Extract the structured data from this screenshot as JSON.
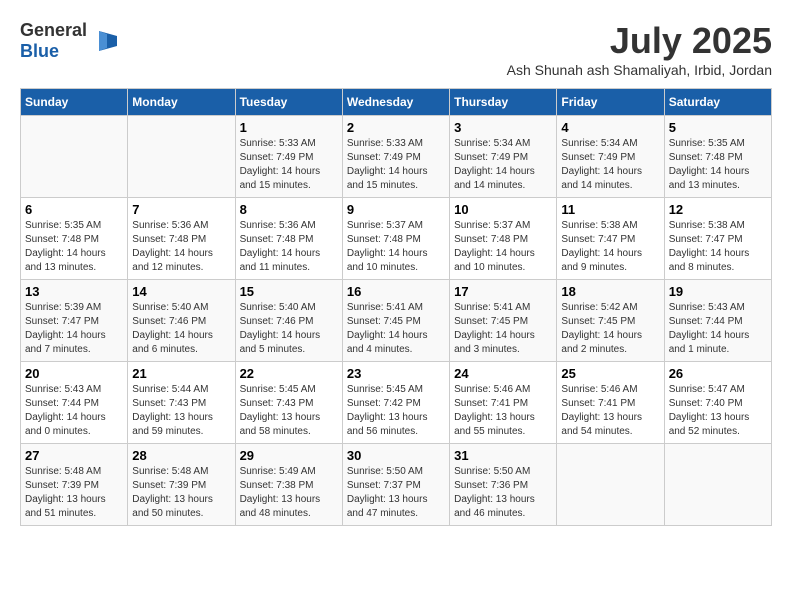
{
  "header": {
    "logo_general": "General",
    "logo_blue": "Blue",
    "month": "July 2025",
    "location": "Ash Shunah ash Shamaliyah, Irbid, Jordan"
  },
  "days_of_week": [
    "Sunday",
    "Monday",
    "Tuesday",
    "Wednesday",
    "Thursday",
    "Friday",
    "Saturday"
  ],
  "weeks": [
    [
      {
        "day": "",
        "sunrise": "",
        "sunset": "",
        "daylight": ""
      },
      {
        "day": "",
        "sunrise": "",
        "sunset": "",
        "daylight": ""
      },
      {
        "day": "1",
        "sunrise": "Sunrise: 5:33 AM",
        "sunset": "Sunset: 7:49 PM",
        "daylight": "Daylight: 14 hours and 15 minutes."
      },
      {
        "day": "2",
        "sunrise": "Sunrise: 5:33 AM",
        "sunset": "Sunset: 7:49 PM",
        "daylight": "Daylight: 14 hours and 15 minutes."
      },
      {
        "day": "3",
        "sunrise": "Sunrise: 5:34 AM",
        "sunset": "Sunset: 7:49 PM",
        "daylight": "Daylight: 14 hours and 14 minutes."
      },
      {
        "day": "4",
        "sunrise": "Sunrise: 5:34 AM",
        "sunset": "Sunset: 7:49 PM",
        "daylight": "Daylight: 14 hours and 14 minutes."
      },
      {
        "day": "5",
        "sunrise": "Sunrise: 5:35 AM",
        "sunset": "Sunset: 7:48 PM",
        "daylight": "Daylight: 14 hours and 13 minutes."
      }
    ],
    [
      {
        "day": "6",
        "sunrise": "Sunrise: 5:35 AM",
        "sunset": "Sunset: 7:48 PM",
        "daylight": "Daylight: 14 hours and 13 minutes."
      },
      {
        "day": "7",
        "sunrise": "Sunrise: 5:36 AM",
        "sunset": "Sunset: 7:48 PM",
        "daylight": "Daylight: 14 hours and 12 minutes."
      },
      {
        "day": "8",
        "sunrise": "Sunrise: 5:36 AM",
        "sunset": "Sunset: 7:48 PM",
        "daylight": "Daylight: 14 hours and 11 minutes."
      },
      {
        "day": "9",
        "sunrise": "Sunrise: 5:37 AM",
        "sunset": "Sunset: 7:48 PM",
        "daylight": "Daylight: 14 hours and 10 minutes."
      },
      {
        "day": "10",
        "sunrise": "Sunrise: 5:37 AM",
        "sunset": "Sunset: 7:48 PM",
        "daylight": "Daylight: 14 hours and 10 minutes."
      },
      {
        "day": "11",
        "sunrise": "Sunrise: 5:38 AM",
        "sunset": "Sunset: 7:47 PM",
        "daylight": "Daylight: 14 hours and 9 minutes."
      },
      {
        "day": "12",
        "sunrise": "Sunrise: 5:38 AM",
        "sunset": "Sunset: 7:47 PM",
        "daylight": "Daylight: 14 hours and 8 minutes."
      }
    ],
    [
      {
        "day": "13",
        "sunrise": "Sunrise: 5:39 AM",
        "sunset": "Sunset: 7:47 PM",
        "daylight": "Daylight: 14 hours and 7 minutes."
      },
      {
        "day": "14",
        "sunrise": "Sunrise: 5:40 AM",
        "sunset": "Sunset: 7:46 PM",
        "daylight": "Daylight: 14 hours and 6 minutes."
      },
      {
        "day": "15",
        "sunrise": "Sunrise: 5:40 AM",
        "sunset": "Sunset: 7:46 PM",
        "daylight": "Daylight: 14 hours and 5 minutes."
      },
      {
        "day": "16",
        "sunrise": "Sunrise: 5:41 AM",
        "sunset": "Sunset: 7:45 PM",
        "daylight": "Daylight: 14 hours and 4 minutes."
      },
      {
        "day": "17",
        "sunrise": "Sunrise: 5:41 AM",
        "sunset": "Sunset: 7:45 PM",
        "daylight": "Daylight: 14 hours and 3 minutes."
      },
      {
        "day": "18",
        "sunrise": "Sunrise: 5:42 AM",
        "sunset": "Sunset: 7:45 PM",
        "daylight": "Daylight: 14 hours and 2 minutes."
      },
      {
        "day": "19",
        "sunrise": "Sunrise: 5:43 AM",
        "sunset": "Sunset: 7:44 PM",
        "daylight": "Daylight: 14 hours and 1 minute."
      }
    ],
    [
      {
        "day": "20",
        "sunrise": "Sunrise: 5:43 AM",
        "sunset": "Sunset: 7:44 PM",
        "daylight": "Daylight: 14 hours and 0 minutes."
      },
      {
        "day": "21",
        "sunrise": "Sunrise: 5:44 AM",
        "sunset": "Sunset: 7:43 PM",
        "daylight": "Daylight: 13 hours and 59 minutes."
      },
      {
        "day": "22",
        "sunrise": "Sunrise: 5:45 AM",
        "sunset": "Sunset: 7:43 PM",
        "daylight": "Daylight: 13 hours and 58 minutes."
      },
      {
        "day": "23",
        "sunrise": "Sunrise: 5:45 AM",
        "sunset": "Sunset: 7:42 PM",
        "daylight": "Daylight: 13 hours and 56 minutes."
      },
      {
        "day": "24",
        "sunrise": "Sunrise: 5:46 AM",
        "sunset": "Sunset: 7:41 PM",
        "daylight": "Daylight: 13 hours and 55 minutes."
      },
      {
        "day": "25",
        "sunrise": "Sunrise: 5:46 AM",
        "sunset": "Sunset: 7:41 PM",
        "daylight": "Daylight: 13 hours and 54 minutes."
      },
      {
        "day": "26",
        "sunrise": "Sunrise: 5:47 AM",
        "sunset": "Sunset: 7:40 PM",
        "daylight": "Daylight: 13 hours and 52 minutes."
      }
    ],
    [
      {
        "day": "27",
        "sunrise": "Sunrise: 5:48 AM",
        "sunset": "Sunset: 7:39 PM",
        "daylight": "Daylight: 13 hours and 51 minutes."
      },
      {
        "day": "28",
        "sunrise": "Sunrise: 5:48 AM",
        "sunset": "Sunset: 7:39 PM",
        "daylight": "Daylight: 13 hours and 50 minutes."
      },
      {
        "day": "29",
        "sunrise": "Sunrise: 5:49 AM",
        "sunset": "Sunset: 7:38 PM",
        "daylight": "Daylight: 13 hours and 48 minutes."
      },
      {
        "day": "30",
        "sunrise": "Sunrise: 5:50 AM",
        "sunset": "Sunset: 7:37 PM",
        "daylight": "Daylight: 13 hours and 47 minutes."
      },
      {
        "day": "31",
        "sunrise": "Sunrise: 5:50 AM",
        "sunset": "Sunset: 7:36 PM",
        "daylight": "Daylight: 13 hours and 46 minutes."
      },
      {
        "day": "",
        "sunrise": "",
        "sunset": "",
        "daylight": ""
      },
      {
        "day": "",
        "sunrise": "",
        "sunset": "",
        "daylight": ""
      }
    ]
  ]
}
